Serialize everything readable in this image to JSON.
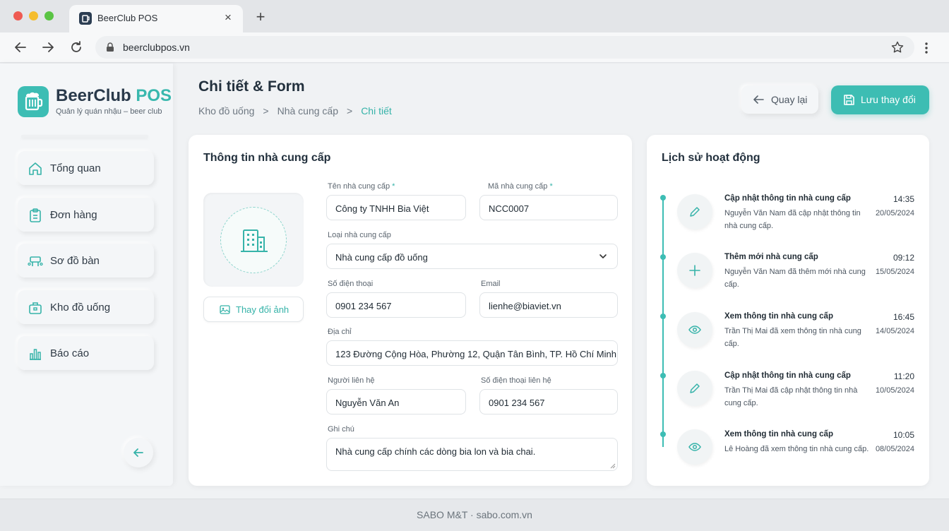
{
  "browser": {
    "tab_title": "BeerClub POS",
    "url": "beerclubpos.vn"
  },
  "brand": {
    "name": "BeerClub",
    "name_accent": "POS",
    "tagline": "Quản lý quán nhậu – beer club"
  },
  "sidebar": {
    "items": [
      {
        "label": "Tổng quan",
        "icon": "home-icon"
      },
      {
        "label": "Đơn hàng",
        "icon": "clipboard-icon"
      },
      {
        "label": "Sơ đồ bàn",
        "icon": "table-map-icon"
      },
      {
        "label": "Kho đồ uống",
        "icon": "warehouse-icon"
      },
      {
        "label": "Báo cáo",
        "icon": "bar-chart-icon"
      }
    ]
  },
  "header": {
    "title": "Chi tiết & Form",
    "breadcrumb": [
      "Kho đồ uống",
      "Nhà cung cấp",
      "Chi tiết"
    ],
    "back_label": "Quay lại",
    "save_label": "Lưu thay đổi"
  },
  "form": {
    "title": "Thông tin nhà cung cấp",
    "change_image_label": "Thay đổi ảnh",
    "fields": {
      "supplier_name": {
        "label": "Tên nhà cung cấp",
        "required": "*",
        "value": "Công ty TNHH Bia Việt"
      },
      "supplier_code": {
        "label": "Mã nhà cung cấp",
        "required": "*",
        "value": "NCC0007"
      },
      "supplier_type": {
        "label": "Loại nhà cung cấp",
        "value": "Nhà cung cấp đồ uống"
      },
      "phone": {
        "label": "Số điện thoại",
        "value": "0901 234 567"
      },
      "email": {
        "label": "Email",
        "value": "lienhe@biaviet.vn"
      },
      "address": {
        "label": "Địa chỉ",
        "value": "123 Đường Cộng Hòa, Phường 12, Quận Tân Bình, TP. Hồ Chí Minh"
      },
      "contact_person": {
        "label": "Người liên hệ",
        "value": "Nguyễn Văn An"
      },
      "contact_phone": {
        "label": "Số điện thoại liên hệ",
        "value": "0901 234 567"
      },
      "note": {
        "label": "Ghi chú",
        "value": "Nhà cung cấp chính các dòng bia lon và bia chai."
      }
    }
  },
  "activity": {
    "title": "Lịch sử hoạt động",
    "items": [
      {
        "icon": "pencil-icon",
        "title": "Cập nhật thông tin nhà cung cấp",
        "desc": "Nguyễn Văn Nam đã cập nhật thông tin nhà cung cấp.",
        "time": "14:35",
        "date": "20/05/2024"
      },
      {
        "icon": "plus-icon",
        "title": "Thêm mới nhà cung cấp",
        "desc": "Nguyễn Văn Nam đã thêm mới nhà cung cấp.",
        "time": "09:12",
        "date": "15/05/2024"
      },
      {
        "icon": "eye-icon",
        "title": "Xem thông tin nhà cung cấp",
        "desc": "Trần Thị Mai đã xem thông tin nhà cung cấp.",
        "time": "16:45",
        "date": "14/05/2024"
      },
      {
        "icon": "pencil-icon",
        "title": "Cập nhật thông tin nhà cung cấp",
        "desc": "Trần Thị Mai đã cập nhật thông tin nhà cung cấp.",
        "time": "11:20",
        "date": "10/05/2024"
      },
      {
        "icon": "eye-icon",
        "title": "Xem thông tin nhà cung cấp",
        "desc": "Lê Hoàng đã xem thông tin nhà cung cấp.",
        "time": "10:05",
        "date": "08/05/2024"
      }
    ]
  },
  "footer": {
    "text": "SABO M&T · sabo.com.vn"
  },
  "colors": {
    "accent": "#3dbdb4",
    "text_dark": "#22303d"
  }
}
